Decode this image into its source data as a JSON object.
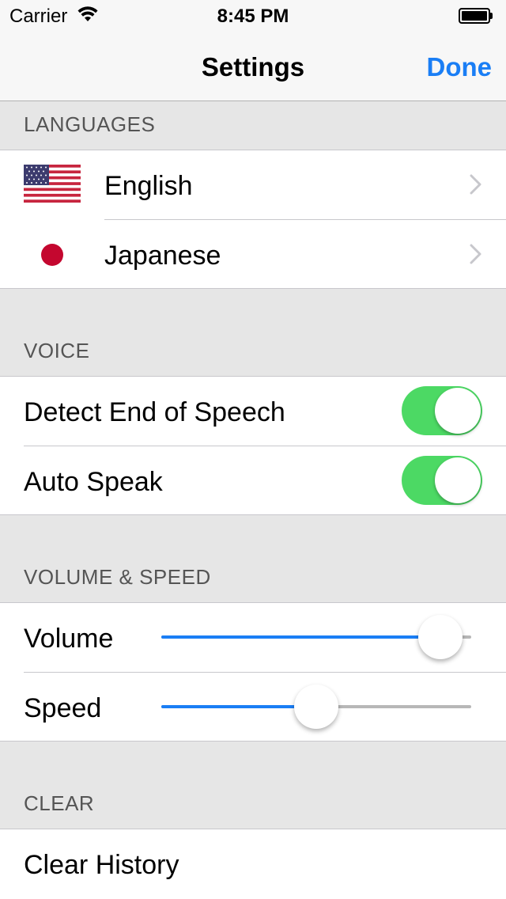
{
  "status_bar": {
    "carrier": "Carrier",
    "time": "8:45 PM",
    "wifi_icon": "wifi-icon",
    "battery_icon": "battery-icon"
  },
  "nav": {
    "title": "Settings",
    "done_label": "Done"
  },
  "colors": {
    "accent": "#1a7ef5",
    "toggle_on": "#4cd964",
    "japan_red": "#c4072f"
  },
  "sections": {
    "languages": {
      "header": "LANGUAGES",
      "items": [
        {
          "label": "English",
          "icon": "us-flag-icon"
        },
        {
          "label": "Japanese",
          "icon": "japan-flag-icon"
        }
      ]
    },
    "voice": {
      "header": "VOICE",
      "items": [
        {
          "label": "Detect End of Speech",
          "on": true
        },
        {
          "label": "Auto Speak",
          "on": true
        }
      ]
    },
    "volume_speed": {
      "header": "VOLUME & SPEED",
      "items": [
        {
          "label": "Volume",
          "value": 0.9
        },
        {
          "label": "Speed",
          "value": 0.5
        }
      ]
    },
    "clear": {
      "header": "CLEAR",
      "items": [
        {
          "label": "Clear History"
        }
      ]
    }
  }
}
